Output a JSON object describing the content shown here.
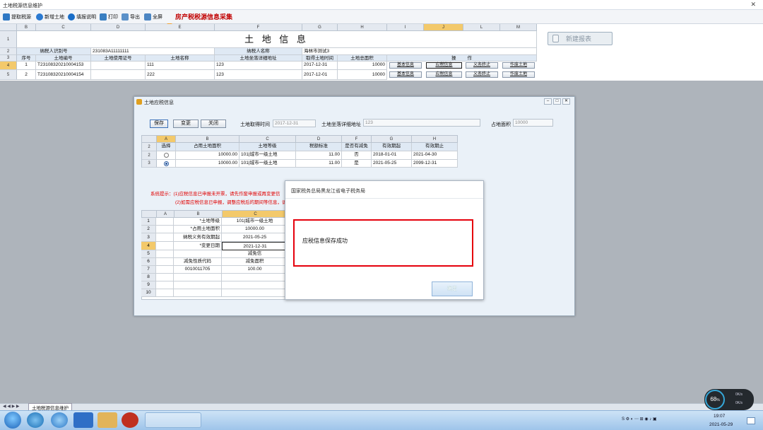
{
  "window": {
    "title": "土地税源信息维护",
    "close": "✕"
  },
  "toolbar": {
    "items": [
      {
        "label": "提取税源",
        "icon": "extract-icon"
      },
      {
        "label": "新增土地",
        "icon": "add-icon"
      },
      {
        "label": "填报说明",
        "icon": "help-icon"
      },
      {
        "label": "打印",
        "icon": "print-icon"
      },
      {
        "label": "导出",
        "icon": "export-icon"
      },
      {
        "label": "全屏",
        "icon": "fullscreen-icon"
      }
    ],
    "title": "房产税税源信息采集"
  },
  "main_grid": {
    "col_headers": [
      "B",
      "C",
      "D",
      "E",
      "F",
      "G",
      "H",
      "I",
      "J",
      "L",
      "M"
    ],
    "row_headers": [
      "1",
      "2",
      "3",
      "4",
      "5"
    ],
    "title": "土 地 信 息",
    "taxpayer_id_label": "纳税人识别号",
    "taxpayer_id": "231083A11111111",
    "taxpayer_name_label": "纳税人名称",
    "taxpayer_name": "海林市测试3",
    "headers": [
      "序号",
      "土地编号",
      "土地使用证号",
      "土地名称",
      "土地坐落详细地址",
      "取得土地时间",
      "土地总面积",
      "操",
      "作"
    ],
    "rows": [
      {
        "no": "1",
        "code": "T23108320210004153",
        "cert": "",
        "name": "111",
        "addr": "123",
        "date": "2017-12-31",
        "area": "10000",
        "b1": "基本信息",
        "b2": "应税信息",
        "b3": "义务终止",
        "b4": "作废土地"
      },
      {
        "no": "2",
        "code": "T23108320210004154",
        "cert": "",
        "name": "222",
        "addr": "123",
        "date": "2017-12-01",
        "area": "10000",
        "b1": "基本信息",
        "b2": "应税信息",
        "b3": "义务终止",
        "b4": "作废土地"
      }
    ]
  },
  "new_report": "新建报表",
  "dialog": {
    "title": "土地应税信息",
    "buttons": [
      "保存",
      "变更",
      "关闭"
    ],
    "get_time_label": "土地取得时间",
    "get_time": "2017-12-31",
    "addr_label": "土地坐落详细地址",
    "addr": "123",
    "area_label": "占地面积",
    "area": "10000",
    "sub_cols": [
      "A",
      "B",
      "C",
      "D",
      "F",
      "G",
      "H"
    ],
    "sub_headers": [
      "选择",
      "占用土地面积",
      "土地等级",
      "税额标准",
      "是否有减免",
      "有效期起",
      "有效期止"
    ],
    "sub_rows": [
      {
        "rn": "2",
        "area": "10000.00",
        "grade": "101|城市一级土地",
        "std": "11.00",
        "relief": "否",
        "from": "2018-01-01",
        "to": "2021-04-30"
      },
      {
        "rn": "3",
        "area": "10000.00",
        "grade": "101|城市一级土地",
        "std": "11.00",
        "relief": "是",
        "from": "2021-05-25",
        "to": "2099-12-31"
      }
    ],
    "sys_tip_1": "系统提示：(1)应税信息已申报未开票，请先作废申报或再变更信",
    "sys_tip_2": "(2)如需应税信息已申报，调整应税后的期间等信息，请到",
    "detail_cols": [
      "A",
      "B",
      "C"
    ],
    "detail": [
      {
        "rn": "1",
        "label": "*土地等级",
        "value": "101|城市一级土地"
      },
      {
        "rn": "2",
        "label": "*占用土地面积",
        "value": "10000.00"
      },
      {
        "rn": "3",
        "label": "纳税义务有效期起",
        "value": "2021-05-25"
      },
      {
        "rn": "4",
        "label": "*变更日期",
        "value": "2021-12-31"
      },
      {
        "rn": "5",
        "label": "",
        "value": "减免信"
      },
      {
        "rn": "6",
        "label": "减免性质代码",
        "value": "减免面积"
      },
      {
        "rn": "7",
        "label": "0010011705",
        "value": "100.00"
      },
      {
        "rn": "8",
        "label": "",
        "value": ""
      },
      {
        "rn": "9",
        "label": "",
        "value": ""
      },
      {
        "rn": "10",
        "label": "",
        "value": ""
      }
    ]
  },
  "message": {
    "title": "国家税务总局黑龙江省电子税务局",
    "text": "应税信息保存成功",
    "ok": "确定"
  },
  "sheet_tab": "土地税源信息维护",
  "gauge": {
    "percent": "68",
    "unit": "%",
    "up": "0K/s",
    "down": "0K/s"
  },
  "clock": {
    "time": "19:07",
    "date": "2021-05-29"
  },
  "colors": {
    "accent_red": "#e5000c",
    "title_red": "#c00000",
    "taskbar": "#9ec4ea"
  }
}
